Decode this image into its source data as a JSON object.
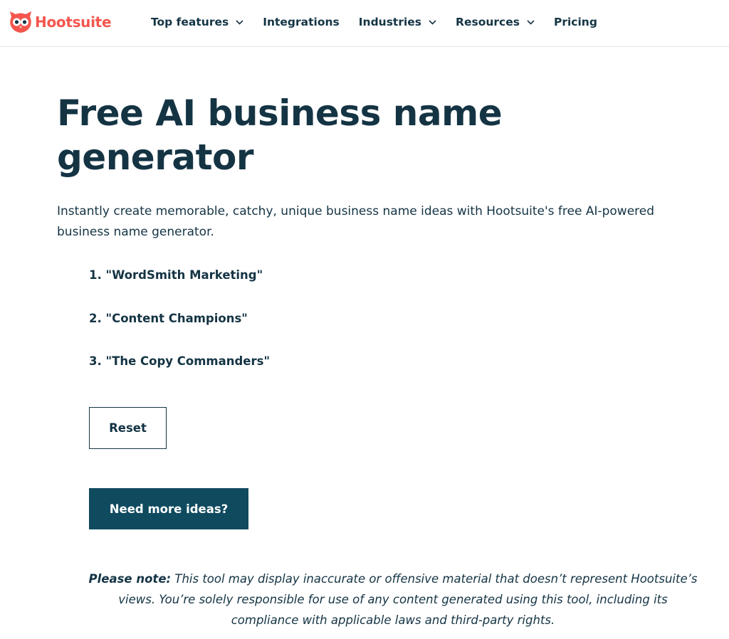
{
  "brand": {
    "name": "Hootsuite",
    "color": "#f4564e"
  },
  "nav": {
    "items": [
      {
        "label": "Top features",
        "has_dropdown": true
      },
      {
        "label": "Integrations",
        "has_dropdown": false
      },
      {
        "label": "Industries",
        "has_dropdown": true
      },
      {
        "label": "Resources",
        "has_dropdown": true
      },
      {
        "label": "Pricing",
        "has_dropdown": false
      }
    ]
  },
  "main": {
    "title_line1": "Free AI business name",
    "title_line2": "generator",
    "intro_line1": "Instantly create memorable, catchy, unique business name ideas with Hootsuite's free AI-powered",
    "intro_line2": "business name generator.",
    "results": [
      "1. \"WordSmith Marketing\"",
      "2. \"Content Champions\"",
      "3. \"The Copy Commanders\""
    ],
    "reset_label": "Reset",
    "more_label": "Need more ideas?",
    "accent_color": "#0f4a5f",
    "text_color": "#143444"
  },
  "note": {
    "label": "Please note:",
    "line1": "This tool may display inaccurate or offensive material that doesn’t represent Hootsuite’s",
    "line2": "views. You’re solely responsible for use of any content generated using this tool, including its",
    "line3": "compliance with applicable laws and third-party rights."
  }
}
